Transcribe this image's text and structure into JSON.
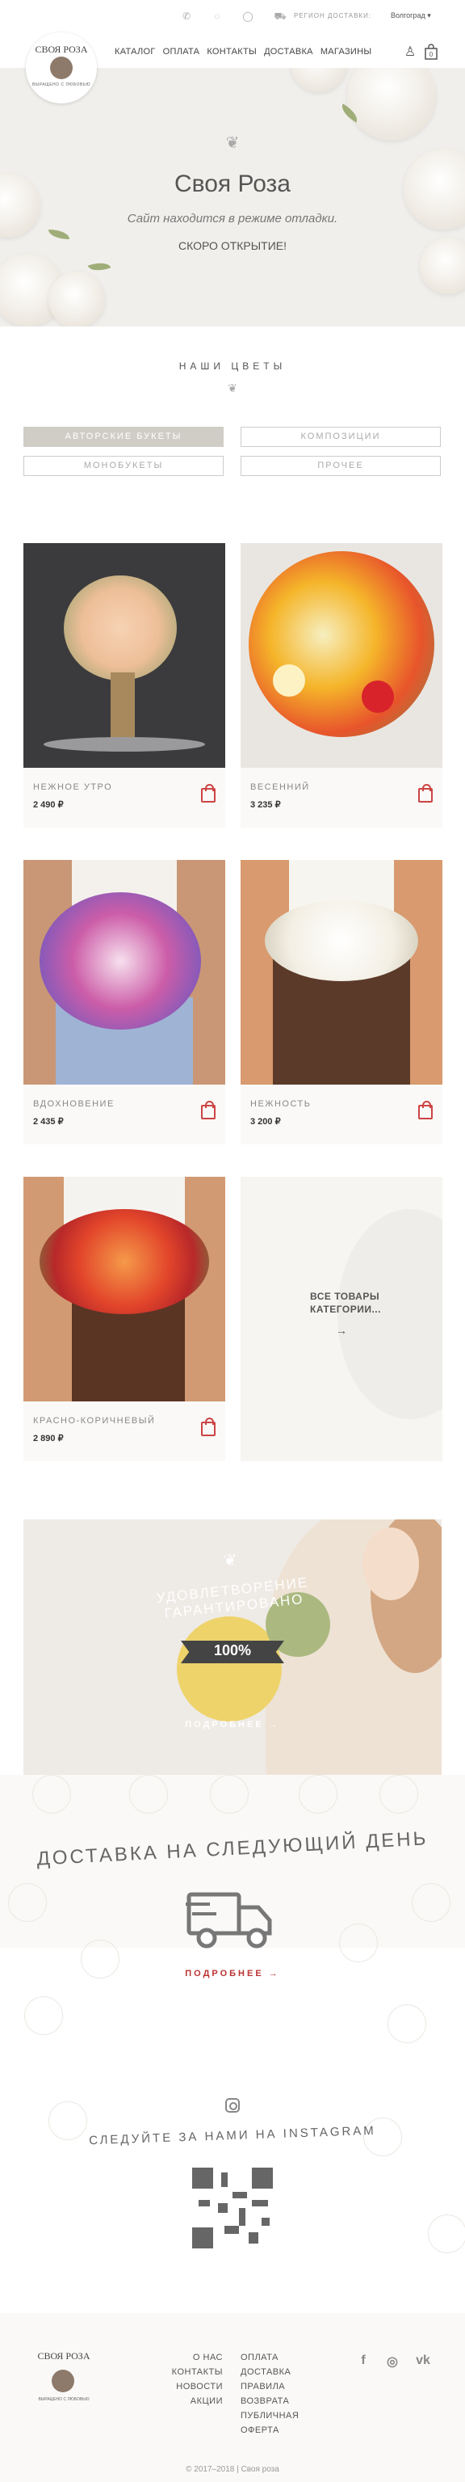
{
  "topbar": {
    "region_label": "РЕГИОН ДОСТАВКИ:",
    "region_value": "Волгоград ▾",
    "icons": [
      "phone-icon",
      "viber-icon",
      "whatsapp-icon",
      "truck-icon"
    ]
  },
  "logo": {
    "name": "СВОЯ РОЗА",
    "tagline": "ВЫРАЩЕНО С ЛЮБОВЬЮ"
  },
  "nav": {
    "items": [
      {
        "label": "КАТАЛОГ"
      },
      {
        "label": "ОПЛАТА"
      },
      {
        "label": "КОНТАКТЫ"
      },
      {
        "label": "ДОСТАВКА"
      },
      {
        "label": "МАГАЗИНЫ"
      }
    ],
    "cart_count": "0"
  },
  "hero": {
    "title": "Своя Роза",
    "subtitle": "Сайт находится в режиме отладки.",
    "soon": "СКОРО ОТКРЫТИЕ!"
  },
  "flowers": {
    "title": "НАШИ ЦВЕТЫ",
    "filters": [
      {
        "label": "АВТОРСКИЕ БУКЕТЫ",
        "active": true
      },
      {
        "label": "КОМПОЗИЦИИ",
        "active": false
      },
      {
        "label": "МОНОБУКЕТЫ",
        "active": false
      },
      {
        "label": "ПРОЧЕЕ",
        "active": false
      }
    ],
    "products": [
      {
        "name": "НЕЖНОЕ УТРО",
        "price": "2 490 ₽"
      },
      {
        "name": "ВЕСЕННИЙ",
        "price": "3 235 ₽"
      },
      {
        "name": "ВДОХНОВЕНИЕ",
        "price": "2 435 ₽"
      },
      {
        "name": "НЕЖНОСТЬ",
        "price": "3 200 ₽"
      },
      {
        "name": "КРАСНО-КОРИЧНЕВЫЙ",
        "price": "2 890 ₽"
      }
    ],
    "all_line1": "ВСЕ ТОВАРЫ",
    "all_line2": "КАТЕГОРИИ...",
    "all_arrow": "→"
  },
  "guarantee": {
    "title": "УДОВЛЕТВОРЕНИЕ ГАРАНТИРОВАНО",
    "percent": "100%",
    "more": "ПОДРОБНЕЕ →"
  },
  "delivery": {
    "title": "ДОСТАВКА НА СЛЕДУЮЩИЙ ДЕНЬ",
    "more": "ПОДРОБНЕЕ →"
  },
  "instagram": {
    "title": "СЛЕДУЙТЕ ЗА НАМИ НА INSTAGRAM"
  },
  "footer": {
    "logo_name": "СВОЯ РОЗА",
    "logo_tagline": "ВЫРАЩЕНО С ЛЮБОВЬЮ",
    "col1": [
      "О НАС",
      "КОНТАКТЫ",
      "НОВОСТИ",
      "АКЦИИ"
    ],
    "col2": [
      "ОПЛАТА",
      "ДОСТАВКА",
      "ПРАВИЛА",
      "ВОЗВРАТА",
      "ПУБЛИЧНАЯ",
      "ОФЕРТА"
    ],
    "social": [
      "f",
      "◎",
      "vk"
    ],
    "copyright": "© 2017–2018 | Своя роза"
  },
  "colors": {
    "accent": "#cc3333",
    "filter_active": "#cfcdc6",
    "hero_bg": "#f1efec"
  }
}
